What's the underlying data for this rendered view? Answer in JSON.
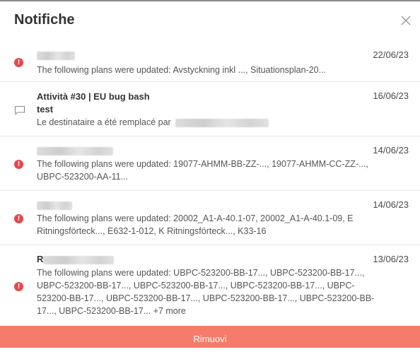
{
  "header": {
    "title": "Notifiche",
    "close_icon": "close-icon"
  },
  "colors": {
    "accent": "#f57b6a",
    "alert": "#e5484d"
  },
  "notifications": [
    {
      "icon": "alert-icon",
      "date": "22/06/23",
      "message": "The following plans were updated: Avstyckning inkl ..., Situationsplan-20..."
    },
    {
      "icon": "comment-icon",
      "date": "16/06/23",
      "title": "Attività #30 | EU bug bash",
      "subtitle": "test",
      "message": "Le destinataire a été remplacé par"
    },
    {
      "icon": "alert-icon",
      "date": "14/06/23",
      "message_lines": [
        "The following plans were updated: 19077-AHMM-BB-ZZ-..., 19077-AHMM-CC-ZZ-...,",
        "UBPC-523200-AA-11..."
      ]
    },
    {
      "icon": "alert-icon",
      "date": "14/06/23",
      "message_lines": [
        "The following plans were updated: 20002_A1-A-40.1-07, 20002_A1-A-40.1-09, E",
        "Ritningsförteck..., E632-1-012, K Ritningsförteck..., K33-16"
      ]
    },
    {
      "icon": "alert-icon",
      "date": "13/06/23",
      "sender_initial": "R",
      "message_lines": [
        "The following plans were updated: UBPC-523200-BB-17..., UBPC-523200-BB-17...,",
        "UBPC-523200-BB-17..., UBPC-523200-BB-17..., UBPC-523200-BB-17..., UBPC-",
        "523200-BB-17..., UBPC-523200-BB-17..., UBPC-523200-BB-17..., UBPC-523200-BB-",
        "17..., UBPC-523200-BB-17... +7 more"
      ]
    }
  ],
  "footer": {
    "remove_label": "Rimuovi"
  }
}
